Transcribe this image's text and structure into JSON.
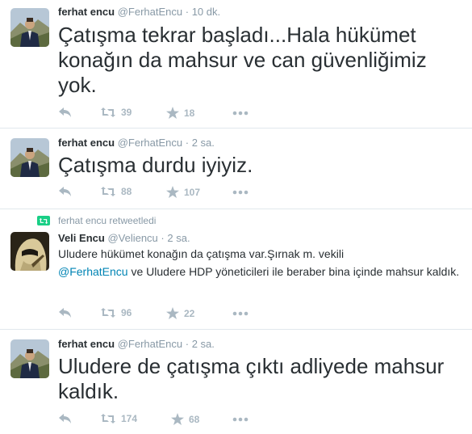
{
  "tweets": [
    {
      "name": "ferhat encu",
      "handle": "@FerhatEncu",
      "dot": "·",
      "time": "10 dk.",
      "text": "Çatışma tekrar başladı...Hala hükümet konağın da mahsur ve can güvenliğimiz yok.",
      "retweets": "39",
      "favorites": "18"
    },
    {
      "name": "ferhat encu",
      "handle": "@FerhatEncu",
      "dot": "·",
      "time": "2 sa.",
      "text": "Çatışma durdu iyiyiz.",
      "retweets": "88",
      "favorites": "107"
    },
    {
      "retweet_context": "ferhat encu retweetledi",
      "name": "Veli Encu",
      "handle": "@Veliencu",
      "dot": "·",
      "time": "2 sa.",
      "text_before": "Uludere hükümet konağın da çatışma var.Şırnak m. vekili",
      "mention": "@FerhatEncu",
      "text_after": " ve Uludere HDP yöneticileri ile beraber bina içinde mahsur kaldık.",
      "retweets": "96",
      "favorites": "22"
    },
    {
      "name": "ferhat encu",
      "handle": "@FerhatEncu",
      "dot": "·",
      "time": "2 sa.",
      "text": "Uludere de çatışma çıktı adliyede mahsur kaldık.",
      "retweets": "174",
      "favorites": "68"
    }
  ],
  "colors": {
    "text": "#292f33",
    "meta": "#8899a6",
    "icon": "#aab8c2",
    "link": "#0084b4",
    "divider": "#e1e8ed",
    "retweet_badge": "#19cf86"
  }
}
